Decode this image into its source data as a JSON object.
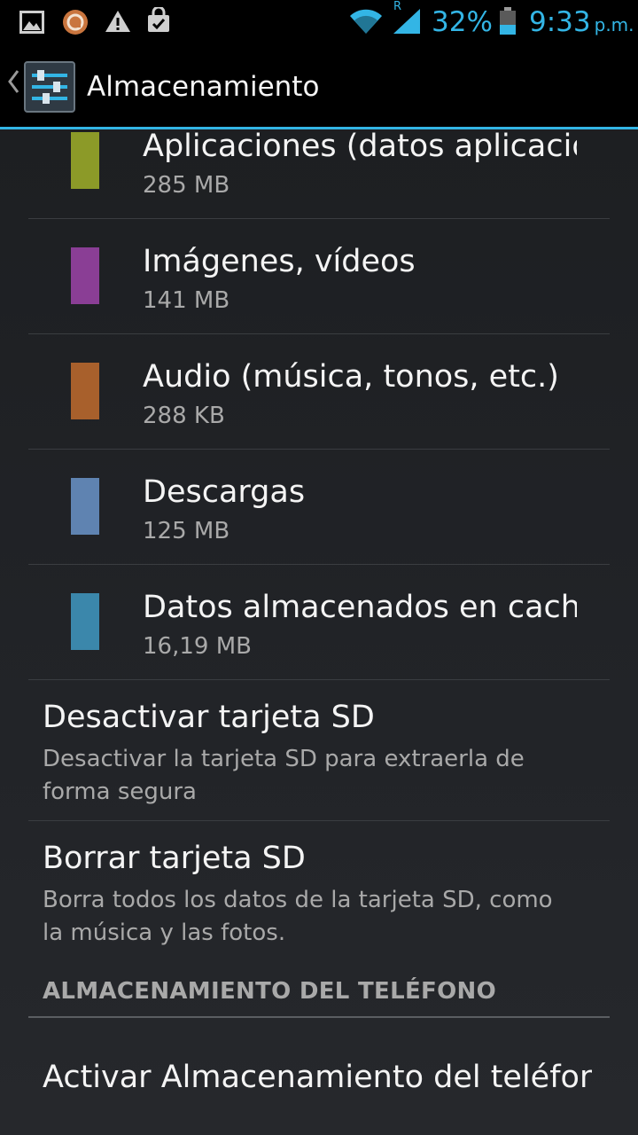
{
  "status_bar": {
    "battery_percent": "32%",
    "time": "9:33",
    "ampm": "p.m.",
    "roaming_indicator": "R",
    "left_icons": [
      "gallery-icon",
      "app-notification-icon",
      "warning-icon",
      "shopping-bag-icon"
    ],
    "right_icons": [
      "wifi-icon",
      "signal-icon",
      "battery-icon"
    ],
    "accent_color": "#33b5e5"
  },
  "action_bar": {
    "title": "Almacenamiento",
    "icon": "settings-sliders-icon"
  },
  "categories": [
    {
      "name": "Aplicaciones (datos aplicaciones)",
      "size": "285 MB",
      "color": "#8c9a28"
    },
    {
      "name": "Imágenes, vídeos",
      "size": "141 MB",
      "color": "#8a3e95"
    },
    {
      "name": "Audio (música, tonos, etc.)",
      "size": "288 KB",
      "color": "#a8602c"
    },
    {
      "name": "Descargas",
      "size": "125 MB",
      "color": "#5f83b1"
    },
    {
      "name": "Datos almacenados en caché",
      "size": "16,19 MB",
      "color": "#3b87ab"
    }
  ],
  "options": [
    {
      "title": "Desactivar tarjeta SD",
      "description": "Desactivar la tarjeta SD para extraerla de forma segura"
    },
    {
      "title": "Borrar tarjeta SD",
      "description": "Borra todos los datos de la tarjeta SD, como la música y las fotos."
    }
  ],
  "section": {
    "header": "ALMACENAMIENTO DEL TELÉFONO",
    "item_title": "Activar Almacenamiento del teléfono"
  }
}
